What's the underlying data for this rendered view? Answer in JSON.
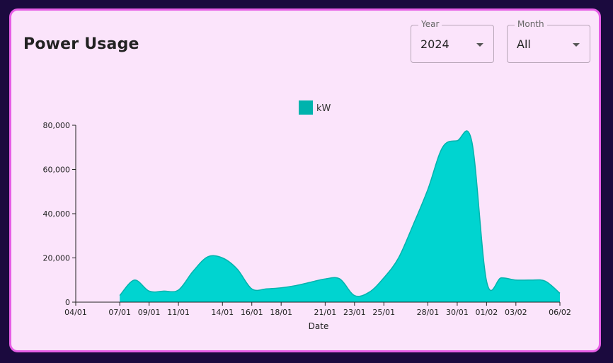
{
  "header": {
    "title": "Power Usage"
  },
  "filters": {
    "year": {
      "label": "Year",
      "value": "2024"
    },
    "month": {
      "label": "Month",
      "value": "All"
    }
  },
  "colors": {
    "fill": "#00d4d0",
    "stroke": "#00b3ad",
    "legend": "#00b3ad"
  },
  "icons": {
    "dropdown": "caret-down-icon"
  },
  "chart_data": {
    "type": "area",
    "title": "",
    "xlabel": "Date",
    "ylabel": "",
    "legend": {
      "position": "top-center",
      "entries": [
        "kW"
      ]
    },
    "x_ticks": [
      "04/01",
      "07/01",
      "09/01",
      "11/01",
      "14/01",
      "16/01",
      "18/01",
      "21/01",
      "23/01",
      "25/01",
      "28/01",
      "30/01",
      "01/02",
      "03/02",
      "06/02"
    ],
    "y_ticks": [
      "0",
      "20,000",
      "40,000",
      "60,000",
      "80,000"
    ],
    "ylim": [
      0,
      80000
    ],
    "xlim": [
      "2024-01-04",
      "2024-02-06"
    ],
    "grid": false,
    "series": [
      {
        "name": "kW",
        "x": [
          "2024-01-07",
          "2024-01-08",
          "2024-01-09",
          "2024-01-10",
          "2024-01-11",
          "2024-01-12",
          "2024-01-13",
          "2024-01-14",
          "2024-01-15",
          "2024-01-16",
          "2024-01-17",
          "2024-01-18",
          "2024-01-19",
          "2024-01-20",
          "2024-01-21",
          "2024-01-22",
          "2024-01-23",
          "2024-01-24",
          "2024-01-25",
          "2024-01-26",
          "2024-01-27",
          "2024-01-28",
          "2024-01-29",
          "2024-01-30",
          "2024-01-31",
          "2024-02-01",
          "2024-02-02",
          "2024-02-03",
          "2024-02-04",
          "2024-02-05",
          "2024-02-06"
        ],
        "values": [
          3000,
          10000,
          5000,
          5000,
          5500,
          14000,
          20500,
          20000,
          15000,
          6000,
          6000,
          6500,
          7500,
          9000,
          10500,
          10500,
          3000,
          4500,
          11000,
          20000,
          35000,
          51000,
          70000,
          73000,
          72500,
          9500,
          11000,
          10000,
          10000,
          9500,
          4000
        ]
      }
    ]
  }
}
